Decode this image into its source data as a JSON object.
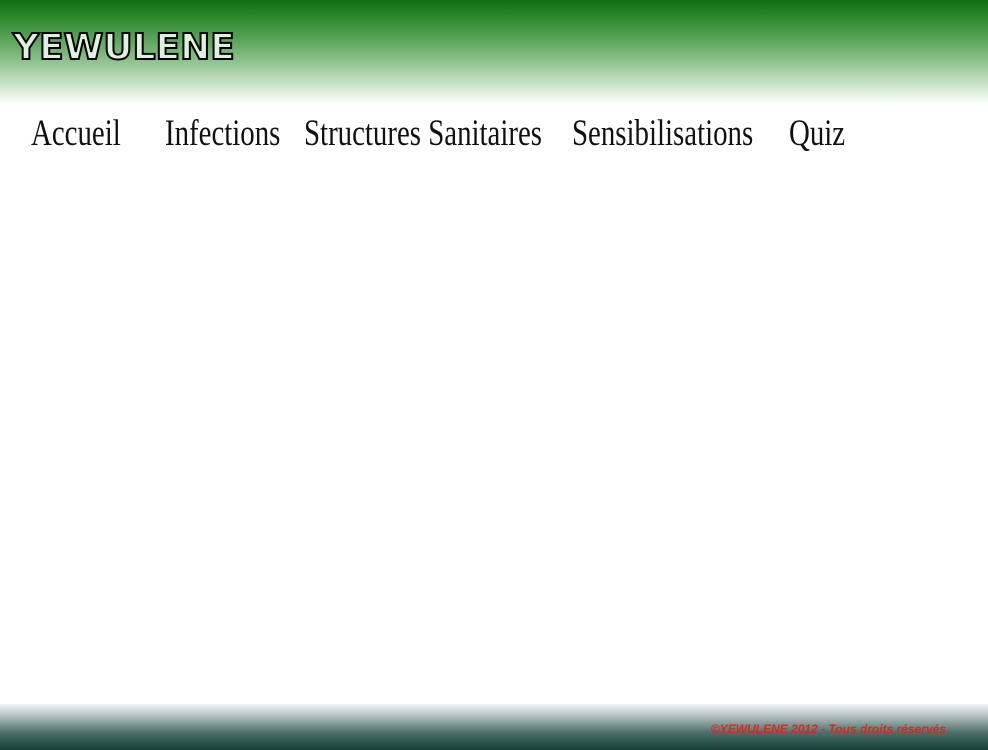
{
  "header": {
    "logo_text": "YEWULENE"
  },
  "nav": {
    "items": [
      {
        "label": "Accueil"
      },
      {
        "label": "Infections"
      },
      {
        "label": "Structures Sanitaires"
      },
      {
        "label": "Sensibilisations"
      },
      {
        "label": "Quiz"
      }
    ]
  },
  "footer": {
    "copyright": "©YEWULENE 2012 - Tous droits réservés"
  },
  "colors": {
    "header_green": "#107010",
    "footer_dark": "#143f37",
    "copyright_red": "#e8201a"
  }
}
